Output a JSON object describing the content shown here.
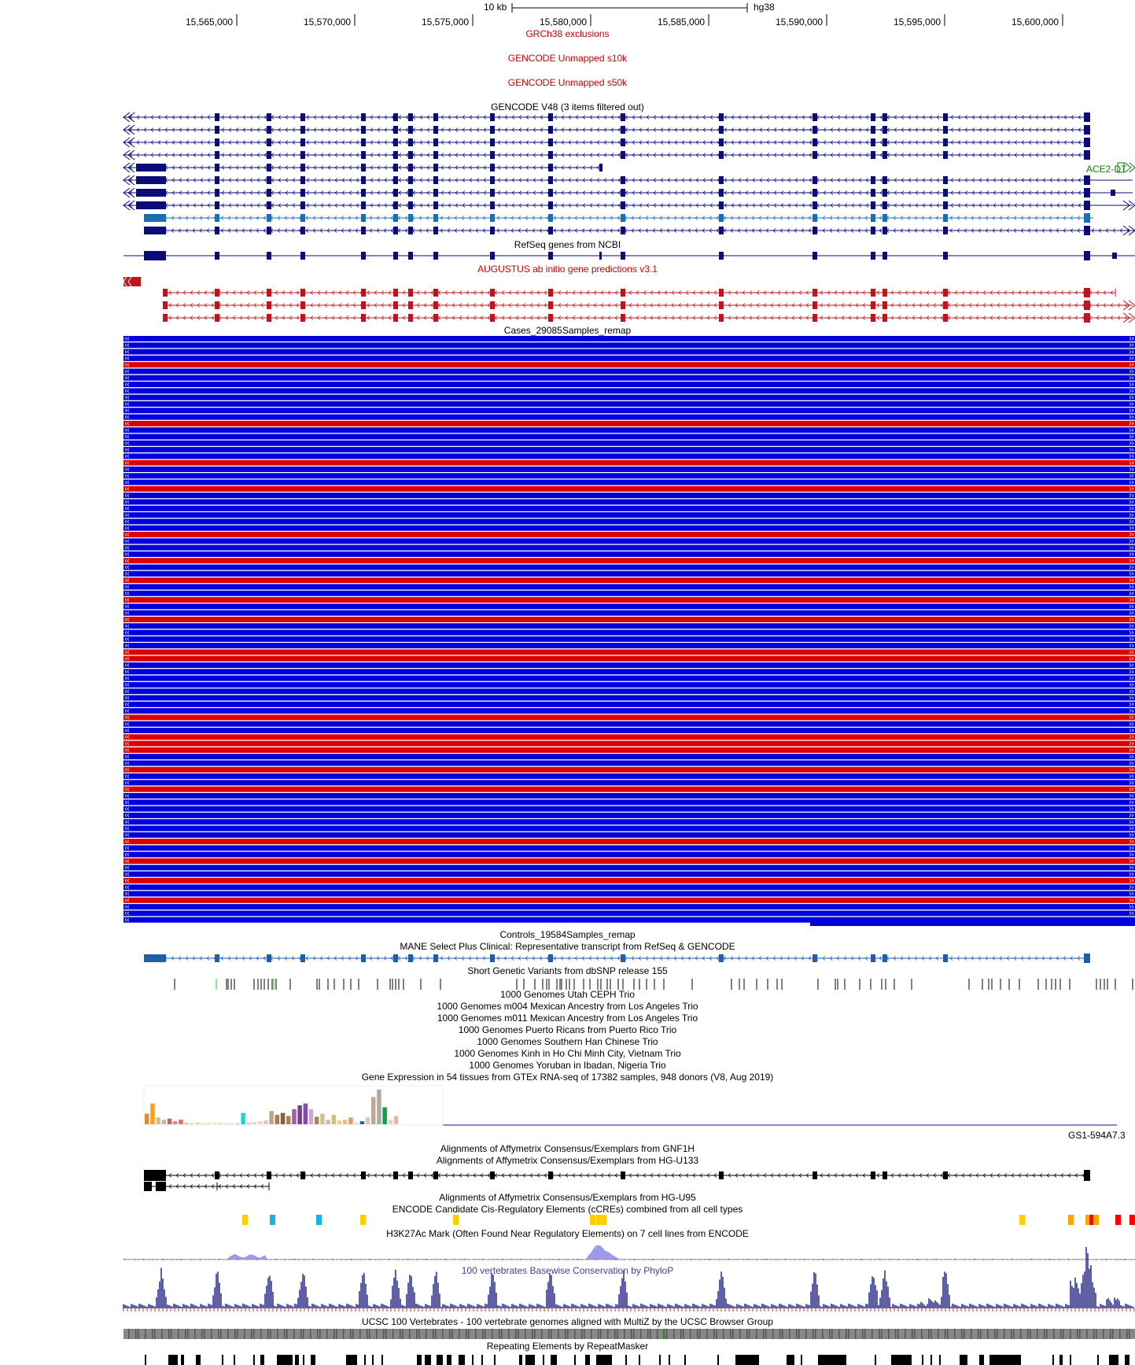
{
  "ruler": {
    "scale_label": "10 kb",
    "assembly": "hg38",
    "ticks": [
      "15,565,000",
      "15,570,000",
      "15,575,000",
      "15,580,000",
      "15,585,000",
      "15,590,000",
      "15,595,000",
      "15,600,000"
    ]
  },
  "colors": {
    "gene_navy": "#0c0c78",
    "gene_teal": "#1a6eb4",
    "augustus_red": "#c0141c",
    "track_red_label": "#cc0000",
    "case_blue": "#0000dc",
    "case_red": "#dc0000",
    "mane_blue": "#1f5fa8",
    "phylop_navy": "#2a2a88",
    "phylop_label": "#404090",
    "ace2_green": "#0a7a0a",
    "ccre_yellow": "#ffcd00",
    "ccre_cyan": "#18b4e8",
    "ccre_orange": "#ffa700",
    "ccre_red": "#ff0000"
  },
  "tracks": {
    "grch38_exclusions": "GRCh38 exclusions",
    "gencode_unmapped_s10k": "GENCODE Unmapped s10k",
    "gencode_unmapped_s50k": "GENCODE Unmapped s50k",
    "gencode_v48": "GENCODE V48 (3 items filtered out)",
    "ace2_label": "ACE2-DT",
    "refseq": "RefSeq genes from NCBI",
    "augustus": "AUGUSTUS ab initio gene predictions v3.1",
    "cases": "Cases_29085Samples_remap",
    "controls": "Controls_19584Samples_remap",
    "mane": "MANE Select Plus Clinical: Representative transcript from RefSeq & GENCODE",
    "dbsnp": "Short Genetic Variants from dbSNP release 155",
    "kg_trios": [
      "1000 Genomes Utah CEPH Trio",
      "1000 Genomes m004 Mexican Ancestry from Los Angeles Trio",
      "1000 Genomes m011 Mexican Ancestry from Los Angeles Trio",
      "1000 Genomes Puerto Ricans from Puerto Rico Trio",
      "1000 Genomes Southern Han Chinese Trio",
      "1000 Genomes Kinh in Ho Chi Minh City, Vietnam Trio",
      "1000 Genomes Yoruban in Ibadan, Nigeria Trio"
    ],
    "gtex": "Gene Expression in 54 tissues from GTEx RNA-seq of 17382 samples, 948 donors (V8, Aug 2019)",
    "gtex_gene": "GS1-594A7.3",
    "affy_gnf1h": "Alignments of Affymetrix Consensus/Exemplars from GNF1H",
    "affy_u133": "Alignments of Affymetrix Consensus/Exemplars from HG-U133",
    "affy_u95": "Alignments of Affymetrix Consensus/Exemplars from HG-U95",
    "encode_ccre": "ENCODE Candidate Cis-Regulatory Elements (cCREs) combined from all cell types",
    "h3k27ac": "H3K27Ac Mark (Often Found Near Regulatory Elements) on 7 cell lines from ENCODE",
    "phylop": "100 vertebrates Basewise Conservation by PhyloP",
    "multiz": "UCSC 100 Vertebrates - 100 vertebrate genomes aligned with MultiZ by the UCSC Browser Group",
    "repeatmasker": "Repeating Elements by RepeatMasker"
  },
  "cases_pattern": "BBBBRBBBBBBBBRBBBBBRBBBRBBBBBBRBBBRBBRBBRBBRBBBBRRBBBBBBBBRBBRRRBBRBBRBBBBBBBRBBRBBRBBRBBB",
  "gtex_bars": [
    {
      "v": 0.28,
      "c": "#e08a3a"
    },
    {
      "v": 0.55,
      "c": "#f5a01a"
    },
    {
      "v": 0.18,
      "c": "#d8c27a"
    },
    {
      "v": 0.12,
      "c": "#bbbbbb"
    },
    {
      "v": 0.15,
      "c": "#e05a5a"
    },
    {
      "v": 0.08,
      "c": "#f08080"
    },
    {
      "v": 0.12,
      "c": "#ee6a50"
    },
    {
      "v": 0.04,
      "c": "#f0c060"
    },
    {
      "v": 0.03,
      "c": "#f6d070"
    },
    {
      "v": 0.04,
      "c": "#f6d070"
    },
    {
      "v": 0.03,
      "c": "#f3e090"
    },
    {
      "v": 0.04,
      "c": "#f3e090"
    },
    {
      "v": 0.03,
      "c": "#f0e0a0"
    },
    {
      "v": 0.04,
      "c": "#eedd99"
    },
    {
      "v": 0.03,
      "c": "#eedd99"
    },
    {
      "v": 0.03,
      "c": "#ddd"
    },
    {
      "v": 0.03,
      "c": "#ccc"
    },
    {
      "v": 0.3,
      "c": "#1ad4d4"
    },
    {
      "v": 0.04,
      "c": "#ccc"
    },
    {
      "v": 0.05,
      "c": "#f0c0c0"
    },
    {
      "v": 0.08,
      "c": "#f5d0d0"
    },
    {
      "v": 0.1,
      "c": "#e8c0c8"
    },
    {
      "v": 0.35,
      "c": "#c9a07a"
    },
    {
      "v": 0.25,
      "c": "#a87a5a"
    },
    {
      "v": 0.3,
      "c": "#8a6040"
    },
    {
      "v": 0.22,
      "c": "#b08060"
    },
    {
      "v": 0.4,
      "c": "#a060a0"
    },
    {
      "v": 0.5,
      "c": "#7a3a9a"
    },
    {
      "v": 0.55,
      "c": "#8a4aa8"
    },
    {
      "v": 0.4,
      "c": "#caa8d0"
    },
    {
      "v": 0.2,
      "c": "#a08a5a"
    },
    {
      "v": 0.28,
      "c": "#d4c090"
    },
    {
      "v": 0.12,
      "c": "#c0c0c0"
    },
    {
      "v": 0.25,
      "c": "#d0c080"
    },
    {
      "v": 0.1,
      "c": "#f0d090"
    },
    {
      "v": 0.12,
      "c": "#e0c090"
    },
    {
      "v": 0.18,
      "c": "#e89a6a"
    },
    {
      "v": 0.05,
      "c": "#ddd"
    },
    {
      "v": 0.08,
      "c": "#1a5ae0"
    },
    {
      "v": 0.18,
      "c": "#d8c8b0"
    },
    {
      "v": 0.72,
      "c": "#c0a890"
    },
    {
      "v": 0.92,
      "c": "#aaaaaa"
    },
    {
      "v": 0.45,
      "c": "#10a040"
    },
    {
      "v": 0.12,
      "c": "#e8d0d0"
    },
    {
      "v": 0.22,
      "c": "#f0b0b0"
    }
  ]
}
